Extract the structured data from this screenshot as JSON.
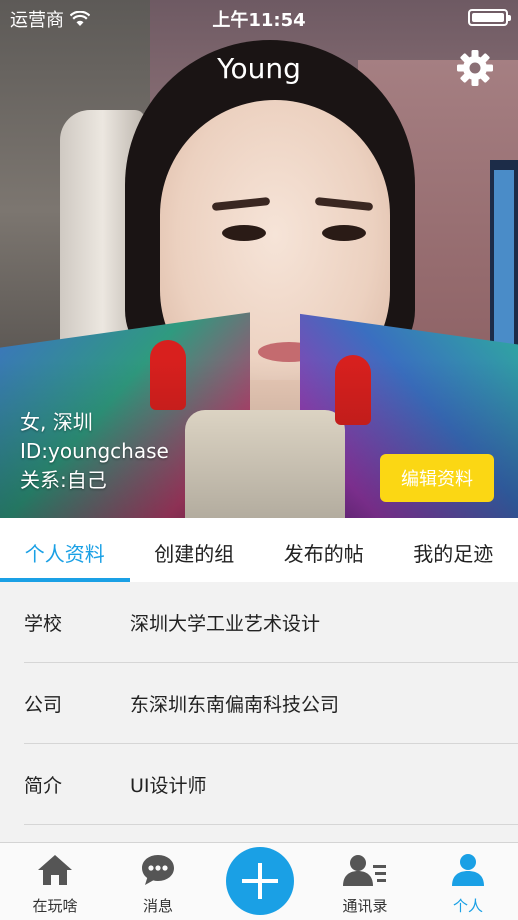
{
  "status_bar": {
    "carrier": "运营商",
    "time": "上午11:54"
  },
  "header": {
    "title": "Young"
  },
  "profile": {
    "gender_city": "女, 深圳",
    "id": "ID:youngchase",
    "relation": "关系:自己",
    "edit_label": "编辑资料"
  },
  "tabs": [
    {
      "label": "个人资料",
      "active": true
    },
    {
      "label": "创建的组",
      "active": false
    },
    {
      "label": "发布的帖",
      "active": false
    },
    {
      "label": "我的足迹",
      "active": false
    }
  ],
  "details": [
    {
      "key": "学校",
      "value": "深圳大学工业艺术设计"
    },
    {
      "key": "公司",
      "value": "东深圳东南偏南科技公司"
    },
    {
      "key": "简介",
      "value": "UI设计师"
    }
  ],
  "tabbar": {
    "items": [
      {
        "label": "在玩啥",
        "icon": "home-icon",
        "active": false
      },
      {
        "label": "消息",
        "icon": "chat-icon",
        "active": false
      },
      {
        "label": "通讯录",
        "icon": "contacts-icon",
        "active": false
      },
      {
        "label": "个人",
        "icon": "person-icon",
        "active": true
      }
    ],
    "plus_icon": "plus-icon"
  },
  "colors": {
    "accent": "#1aa0e5",
    "edit_button": "#fbd714"
  }
}
